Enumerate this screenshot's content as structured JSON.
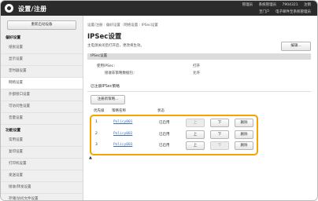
{
  "header": {
    "app_title": "设置/注册",
    "top_info": [
      "管理员",
      "系统管理员",
      "7904321",
      "注销"
    ],
    "links": [
      "至门户",
      "电子邮件至系统管理员"
    ]
  },
  "sidebar": {
    "top_button": "重新启动设备",
    "sections": [
      {
        "title": "偏好设置",
        "items": [
          "纸张设置",
          "显示设置",
          "定时器设置",
          "网络设置",
          "外部接口设置",
          "可访问性设置",
          "音量设置"
        ]
      },
      {
        "title": "功能设置",
        "items": [
          "常用设置",
          "复印设置",
          "打印机设置",
          "发送设置",
          "接收/转发设置",
          "存储/访问文件设置"
        ]
      }
    ]
  },
  "main": {
    "breadcrumb": "设置/注册 : 偏好设置 : 网络设置 : IPSec设置",
    "title": "IPSec设置",
    "note": "主电源关闭后打开后，更改将生效。",
    "edit_button": "编辑...",
    "section_title": "IPSec设置",
    "props": [
      {
        "label": "使用IPSec：",
        "value": "打开"
      },
      {
        "label": "接收非策略数据包：",
        "value": "允许"
      }
    ],
    "registered_title": "已注册IPSec策略",
    "register_button": "注册新策略...",
    "columns": [
      "优先级",
      "策略名称",
      "状态"
    ],
    "policies": [
      {
        "priority": "1",
        "name": "Policy001",
        "status": "已启用",
        "up": "上",
        "down": "下",
        "delete": "删除"
      },
      {
        "priority": "2",
        "name": "Policy002",
        "status": "已启用",
        "up": "上",
        "down": "下",
        "delete": "删除"
      },
      {
        "priority": "3",
        "name": "Policy003",
        "status": "已启用",
        "up": "上",
        "down": "下",
        "delete": "删除"
      }
    ],
    "top_link": "▲"
  }
}
